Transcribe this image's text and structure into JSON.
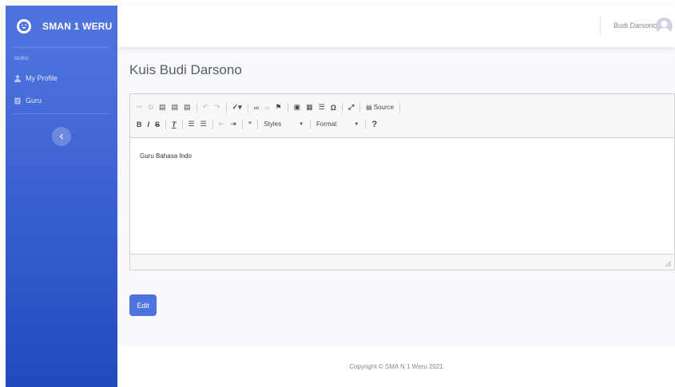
{
  "sidebar": {
    "brand": "SMAN 1 WERU",
    "heading": "GURU",
    "items": [
      {
        "label": "My Profile",
        "icon": "user-icon"
      },
      {
        "label": "Guru",
        "icon": "document-icon"
      }
    ],
    "toggle_icon": "chevron-left-icon"
  },
  "topbar": {
    "user_name": "Budi Darsono"
  },
  "main": {
    "title": "Kuis Budi Darsono",
    "editor": {
      "source_label": "Source",
      "styles_label": "Styles",
      "format_label": "Format",
      "content": "Guru Bahasa Indo"
    },
    "edit_label": "Edit"
  },
  "footer": {
    "copyright": "Copyright © SMA N 1 Weru 2021"
  },
  "colors": {
    "primary": "#4e73df",
    "primary_dark": "#224abe",
    "background": "#f8f9fc",
    "text_muted": "#858796"
  }
}
